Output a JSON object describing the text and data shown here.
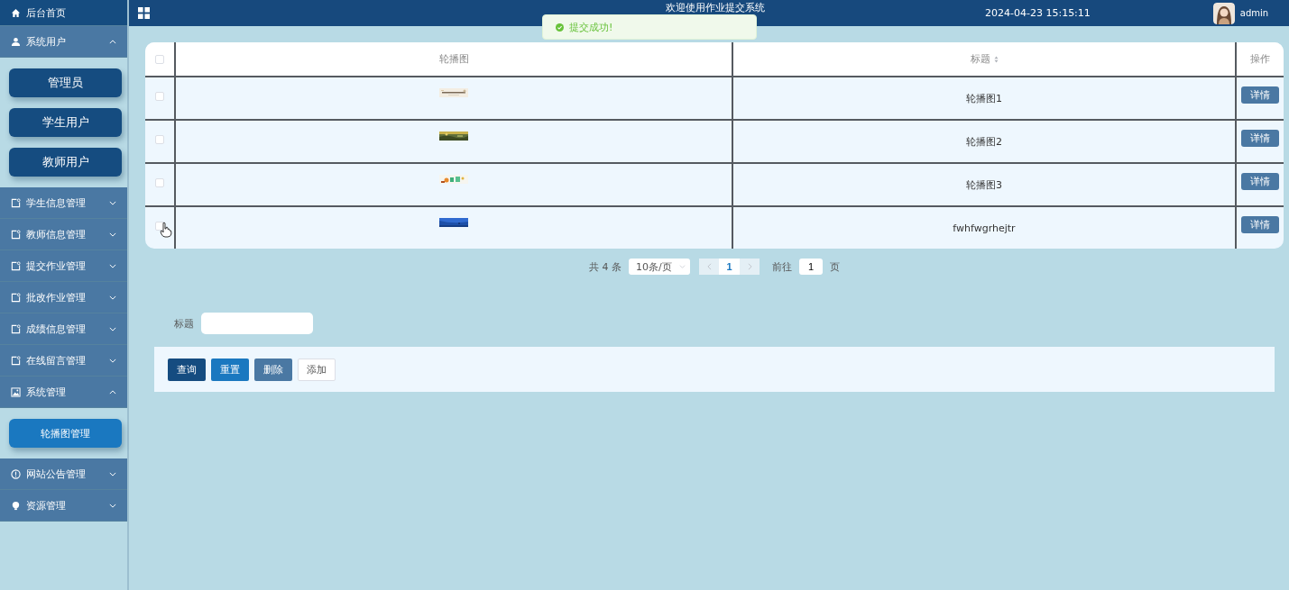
{
  "header": {
    "title": "欢迎使用作业提交系统",
    "datetime": "2024-04-23 15:15:11",
    "user": "admin"
  },
  "toast": {
    "text": "提交成功!"
  },
  "sidebar": {
    "items": [
      {
        "label": "后台首页",
        "kind": "link"
      },
      {
        "label": "系统用户",
        "kind": "group",
        "expanded": true,
        "children": [
          {
            "label": "管理员",
            "selected": false
          },
          {
            "label": "学生用户",
            "selected": false
          },
          {
            "label": "教师用户",
            "selected": false
          }
        ]
      },
      {
        "label": "学生信息管理",
        "kind": "group",
        "expanded": false
      },
      {
        "label": "教师信息管理",
        "kind": "group",
        "expanded": false
      },
      {
        "label": "提交作业管理",
        "kind": "group",
        "expanded": false
      },
      {
        "label": "批改作业管理",
        "kind": "group",
        "expanded": false
      },
      {
        "label": "成绩信息管理",
        "kind": "group",
        "expanded": false
      },
      {
        "label": "在线留言管理",
        "kind": "group",
        "expanded": false
      },
      {
        "label": "系统管理",
        "kind": "group",
        "expanded": true,
        "children": [
          {
            "label": "轮播图管理",
            "selected": true
          }
        ]
      },
      {
        "label": "网站公告管理",
        "kind": "group",
        "expanded": false
      },
      {
        "label": "资源管理",
        "kind": "group",
        "expanded": false
      }
    ]
  },
  "table": {
    "all_checked": false,
    "columns": [
      {
        "label": "轮播图",
        "sortable": false
      },
      {
        "label": "标题",
        "sortable": true
      },
      {
        "label": "操作",
        "sortable": false
      }
    ],
    "rows": [
      {
        "checked": false,
        "title": "轮播图1",
        "action": "详情"
      },
      {
        "checked": false,
        "title": "轮播图2",
        "action": "详情"
      },
      {
        "checked": false,
        "title": "轮播图3",
        "action": "详情"
      },
      {
        "checked": false,
        "title": "fwhfwgrhejtr",
        "action": "详情"
      }
    ]
  },
  "pagination": {
    "total": "共 4 条",
    "page_size": "10条/页",
    "pages": [
      {
        "label": "1",
        "selected": true
      }
    ],
    "goto_label": "前往",
    "goto_value": "1",
    "goto_suffix": "页"
  },
  "search": {
    "label": "标题"
  },
  "buttons": [
    {
      "label": "查询",
      "kind": "dark"
    },
    {
      "label": "重置",
      "kind": "primary"
    },
    {
      "label": "删除",
      "kind": "muted"
    },
    {
      "label": "添加",
      "kind": "plain"
    }
  ]
}
